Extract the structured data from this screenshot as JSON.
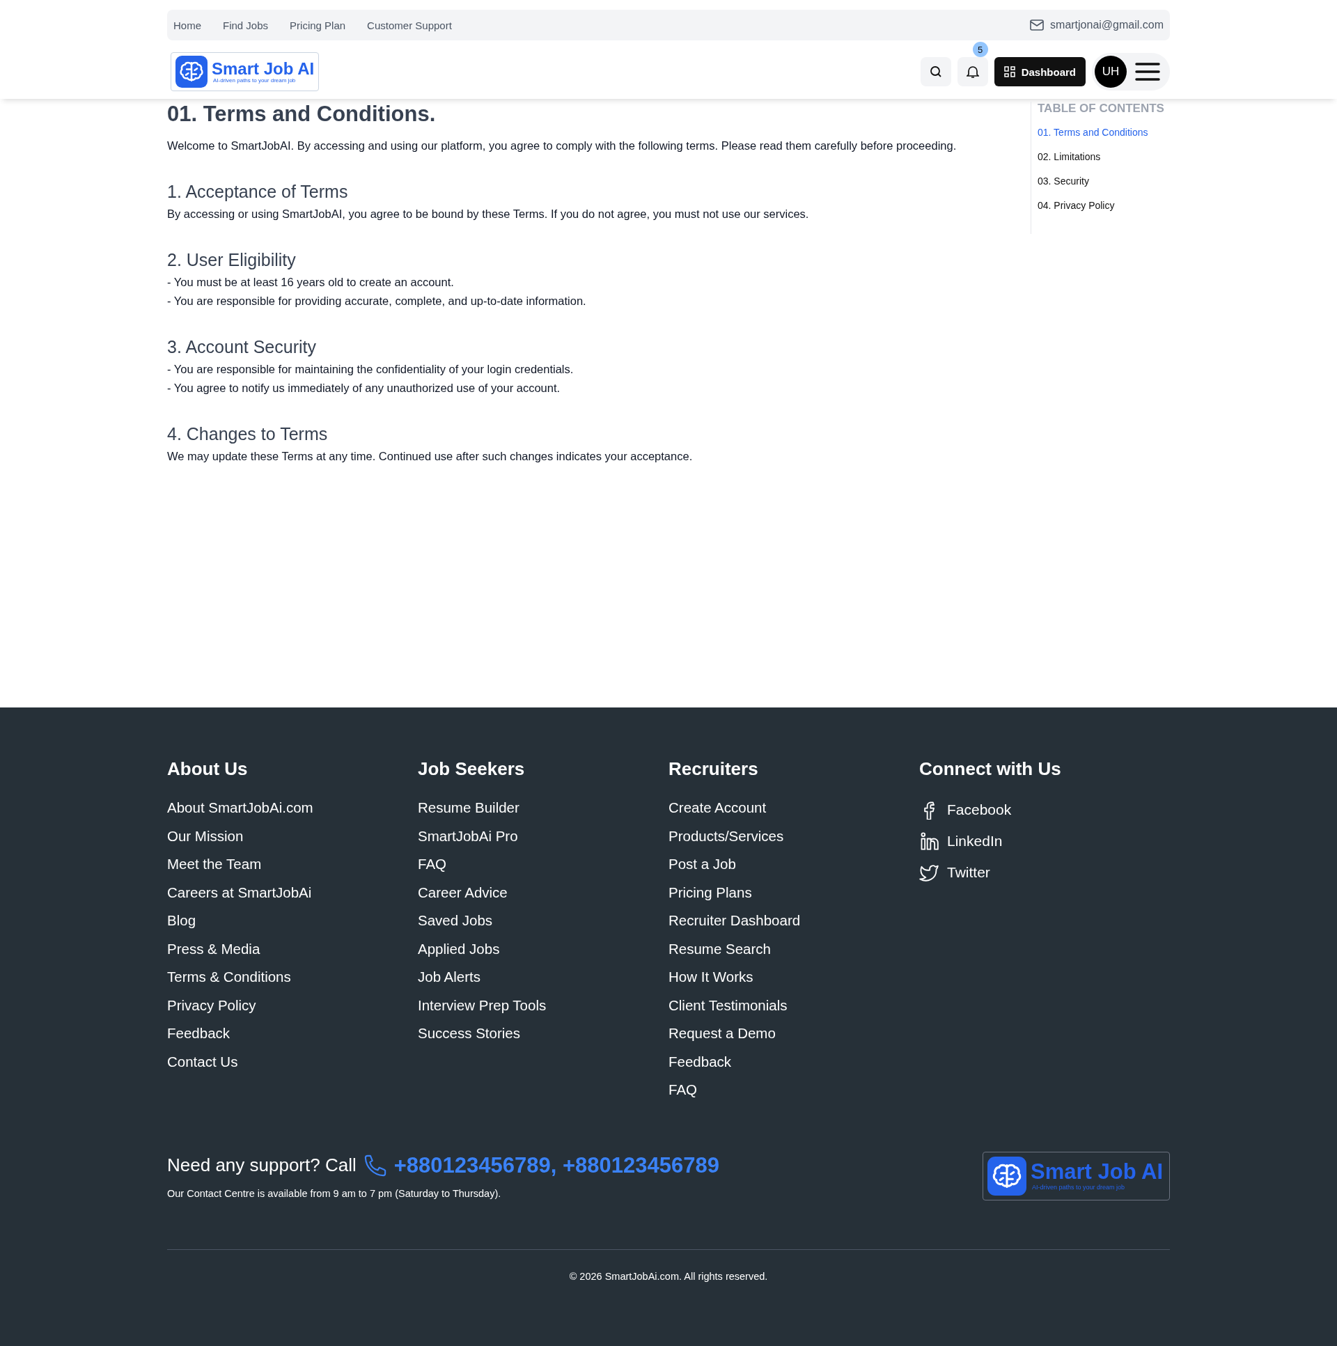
{
  "top_nav": {
    "links": [
      "Home",
      "Find Jobs",
      "Pricing Plan",
      "Customer Support"
    ],
    "email": "smartjonai@gmail.com"
  },
  "header": {
    "logo": {
      "name": "Smart Job AI",
      "tagline": "AI-driven paths to your dream job"
    },
    "notification_count": "5",
    "dashboard_button": "Dashboard",
    "avatar": "UH"
  },
  "content": {
    "title": "01. Terms and Conditions.",
    "intro": "Welcome to SmartJobAI. By accessing and using our platform, you agree to comply with the following terms. Please read them carefully before proceeding.",
    "sections": [
      {
        "heading": "1. Acceptance of Terms",
        "lines": [
          "By accessing or using SmartJobAI, you agree to be bound by these Terms. If you do not agree, you must not use our services."
        ]
      },
      {
        "heading": "2. User Eligibility",
        "lines": [
          "- You must be at least 16 years old to create an account.",
          "- You are responsible for providing accurate, complete, and up-to-date information."
        ]
      },
      {
        "heading": "3. Account Security",
        "lines": [
          "- You are responsible for maintaining the confidentiality of your login credentials.",
          "- You agree to notify us immediately of any unauthorized use of your account."
        ]
      },
      {
        "heading": "4. Changes to Terms",
        "lines": [
          "We may update these Terms at any time. Continued use after such changes indicates your acceptance."
        ]
      }
    ]
  },
  "toc": {
    "title": "TABLE OF CONTENTS",
    "items": [
      {
        "label": "01. Terms and Conditions",
        "selected": true
      },
      {
        "label": "02. Limitations",
        "selected": false
      },
      {
        "label": "03. Security",
        "selected": false
      },
      {
        "label": "04. Privacy Policy",
        "selected": false
      }
    ]
  },
  "footer": {
    "columns": [
      {
        "heading": "About Us",
        "links": [
          "About SmartJobAi.com",
          "Our Mission",
          "Meet the Team",
          "Careers at SmartJobAi",
          "Blog",
          "Press & Media",
          "Terms & Conditions",
          "Privacy Policy",
          "Feedback",
          "Contact Us"
        ]
      },
      {
        "heading": "Job Seekers",
        "links": [
          "Resume Builder",
          "SmartJobAi Pro",
          "FAQ",
          "Career Advice",
          "Saved Jobs",
          "Applied Jobs",
          "Job Alerts",
          "Interview Prep Tools",
          "Success Stories"
        ]
      },
      {
        "heading": "Recruiters",
        "links": [
          "Create Account",
          "Products/Services",
          "Post a Job",
          "Pricing Plans",
          "Recruiter Dashboard",
          "Resume Search",
          "How It Works",
          "Client Testimonials",
          "Request a Demo",
          "Feedback",
          "FAQ"
        ]
      }
    ],
    "social": {
      "heading": "Connect with Us",
      "links": [
        {
          "kind": "facebook",
          "label": "Facebook"
        },
        {
          "kind": "linkedin",
          "label": "LinkedIn"
        },
        {
          "kind": "twitter",
          "label": "Twitter"
        }
      ]
    },
    "support": {
      "text": "Need any support? Call",
      "phones": "+880123456789, +880123456789",
      "hours": "Our Contact Centre is available from 9 am to 7 pm (Saturday to Thursday)."
    },
    "logo": {
      "name": "Smart Job AI",
      "tagline": "AI-driven paths to your dream job"
    },
    "copyright": "© 2026 SmartJobAi.com. All rights reserved."
  }
}
